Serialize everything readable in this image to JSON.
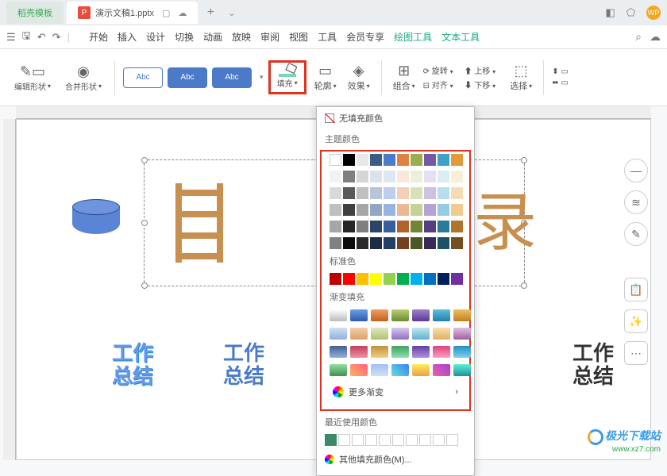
{
  "titlebar": {
    "template_tab": "稻壳模板",
    "doc_tab": "演示文稿1.pptx",
    "icon_letter": "P",
    "avatar": "WP"
  },
  "menus": [
    "开始",
    "插入",
    "设计",
    "切换",
    "动画",
    "放映",
    "审阅",
    "视图",
    "工具",
    "会员专享",
    "绘图工具",
    "文本工具"
  ],
  "ribbon": {
    "edit_shape": "编辑形状",
    "merge_shape": "合并形状",
    "abc": "Abc",
    "fill": "填充",
    "outline": "轮廓",
    "effect": "效果",
    "group": "组合",
    "align": "对齐",
    "rotate": "旋转",
    "moveup": "上移",
    "movedown": "下移",
    "select": "选择"
  },
  "picker": {
    "no_fill": "无填充颜色",
    "theme_label": "主题颜色",
    "standard_label": "标准色",
    "gradient_label": "渐变填充",
    "more_gradient": "更多渐变",
    "recent_label": "最近使用颜色",
    "other_fill": "其他填充颜色(M)...",
    "theme_row1": [
      "#ffffff",
      "#000000",
      "#e8e8e8",
      "#3b5b88",
      "#4e7ac7",
      "#de8344",
      "#9aae4e",
      "#7659a6",
      "#3ea1c6",
      "#e59a3a"
    ],
    "theme_shades": [
      [
        "#f2f2f2",
        "#7f7f7f",
        "#d6d6d6",
        "#dbe2ec",
        "#dde6f3",
        "#f8e7da",
        "#ebefdb",
        "#e6dff0",
        "#dbeef5",
        "#faeeda"
      ],
      [
        "#d9d9d9",
        "#595959",
        "#bfbfbf",
        "#b8c5d8",
        "#bbceea",
        "#f2cfb6",
        "#d8e1b8",
        "#cec1e2",
        "#b8deec",
        "#f5dcb5"
      ],
      [
        "#bfbfbf",
        "#404040",
        "#a6a6a6",
        "#90a6c4",
        "#98b5e0",
        "#ecb791",
        "#c5d296",
        "#b5a3d4",
        "#94cde3",
        "#f0cb90"
      ],
      [
        "#a6a6a6",
        "#262626",
        "#7f7f7f",
        "#2c446a",
        "#365d9c",
        "#b0622a",
        "#738534",
        "#563e81",
        "#2a7b9a",
        "#b2742a"
      ],
      [
        "#808080",
        "#0d0d0d",
        "#2a2a2a",
        "#1d2d46",
        "#243e68",
        "#74411c",
        "#4c5823",
        "#392956",
        "#1c5266",
        "#764d1c"
      ]
    ],
    "standard": [
      "#c00000",
      "#ff0000",
      "#ffc000",
      "#ffff00",
      "#92d050",
      "#00b050",
      "#00b0f0",
      "#0070c0",
      "#002060",
      "#7030a0"
    ],
    "gradients": [
      [
        "linear-gradient(#fff,#bbb)",
        "linear-gradient(#6aa0e8,#2d5aa8)",
        "linear-gradient(#f0a060,#c06020)",
        "linear-gradient(#b8d070,#6a8a30)",
        "linear-gradient(#a080d0,#5a3a90)",
        "linear-gradient(#60c0e0,#2080a8)",
        "linear-gradient(#f0c060,#c08020)"
      ],
      [
        "linear-gradient(#d0e0f0,#90b0e0)",
        "linear-gradient(#f0d0b0,#e0a060)",
        "linear-gradient(#e0e8c0,#b0c070)",
        "linear-gradient(#d8c8f0,#9070c0)",
        "linear-gradient(#c0e8f0,#60b0d0)",
        "linear-gradient(#f8e0b0,#e0b060)",
        "linear-gradient(#e0c0e0,#a060a0)"
      ],
      [
        "linear-gradient(#406090,#90b0e0)",
        "linear-gradient(#c04060,#f090a0)",
        "linear-gradient(#c09040,#f0d080)",
        "linear-gradient(#40a060,#90e0b0)",
        "linear-gradient(#6040a0,#b090e0)",
        "linear-gradient(#e04080,#f8a0c0)",
        "linear-gradient(#2090c0,#80d0f0)"
      ],
      [
        "linear-gradient(#90e0a0,#409050)",
        "linear-gradient(45deg,#ffb060,#ff6080)",
        "linear-gradient(#a0c0f0,#d0e0f8)",
        "linear-gradient(45deg,#60e0e0,#4080f0)",
        "linear-gradient(#f8f060,#f0a040)",
        "linear-gradient(45deg,#f060a0,#a040e0)",
        "linear-gradient(#60f0d0,#2090a0)"
      ]
    ],
    "recent": [
      "#3a8a6a",
      "#ffffff",
      "#ffffff",
      "#ffffff",
      "#ffffff",
      "#ffffff",
      "#ffffff",
      "#ffffff",
      "#ffffff",
      "#ffffff"
    ]
  },
  "slide": {
    "rec_char": "录",
    "work1": "工作",
    "sum1": "总结",
    "work2": "工作",
    "sum2": "总结",
    "work3": "工作",
    "sum3": "总结"
  },
  "watermark": {
    "name": "极光下载站",
    "url": "www.xz7.com"
  }
}
